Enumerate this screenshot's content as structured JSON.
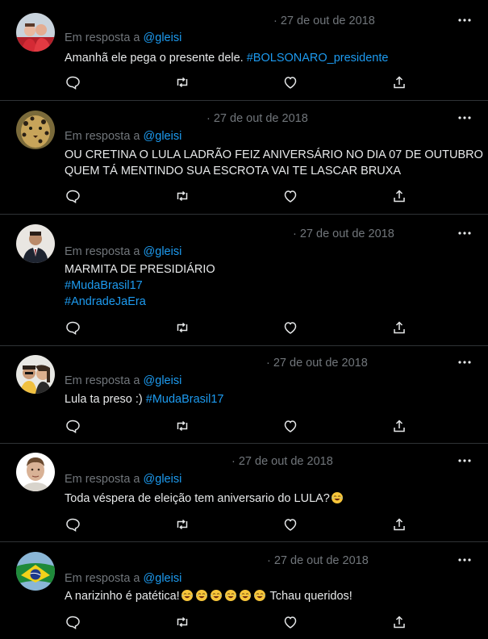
{
  "reply_prefix": "Em resposta a",
  "tweets": [
    {
      "date": "· 27 de out de 2018",
      "reply_to": "@gleisi",
      "lines": [
        {
          "text": "Amanhã ele pega o presente dele. ",
          "hashtag": "#BOLSONARO_presidente"
        }
      ],
      "avatar_icon": "two-people-red-avatar"
    },
    {
      "date": "· 27 de out de 2018",
      "reply_to": "@gleisi",
      "lines": [
        {
          "text": "OU CRETINA O LULA LADRÃO FEIZ ANIVERSÁRIO NO DIA 07 DE OUTUBRO"
        },
        {
          "text": "QUEM TÁ  MENTINDO SUA ESCROTA VAI TE LASCAR BRUXA"
        }
      ],
      "avatar_icon": "leopard-avatar"
    },
    {
      "date": "· 27 de out de 2018",
      "reply_to": "@gleisi",
      "lines": [
        {
          "text": "MARMITA DE PRESIDIÁRIO"
        },
        {
          "text": "",
          "hashtag": "#MudaBrasil17"
        },
        {
          "text": "",
          "hashtag": "#AndradeJaEra"
        }
      ],
      "avatar_icon": "man-in-suit-avatar"
    },
    {
      "date": "· 27 de out de 2018",
      "reply_to": "@gleisi",
      "lines": [
        {
          "text": "Lula ta preso :) ",
          "hashtag": "#MudaBrasil17"
        }
      ],
      "avatar_icon": "couple-selfie-avatar"
    },
    {
      "date": "· 27 de out de 2018",
      "reply_to": "@gleisi",
      "lines": [
        {
          "text": "Toda véspera de eleição tem aniversario do LULA?",
          "emoji_after": 1
        }
      ],
      "avatar_icon": "man-portrait-avatar"
    },
    {
      "date": "· 27 de out de 2018",
      "reply_to": "@gleisi",
      "lines": [
        {
          "text": "A narizinho é patética!",
          "emoji_after": 6,
          "tail": " Tchau queridos!"
        }
      ],
      "avatar_icon": "brazil-flag-avatar"
    }
  ],
  "icons": {
    "more": "more-dots-icon",
    "reply": "reply-icon",
    "retweet": "retweet-icon",
    "like": "like-heart-icon",
    "share": "share-icon",
    "emoji": "face-with-tears-of-joy-emoji"
  },
  "colors": {
    "background": "#000000",
    "text": "#e7e9ea",
    "secondary": "#71767b",
    "link": "#1d9bf0",
    "divider": "#2f3336"
  }
}
